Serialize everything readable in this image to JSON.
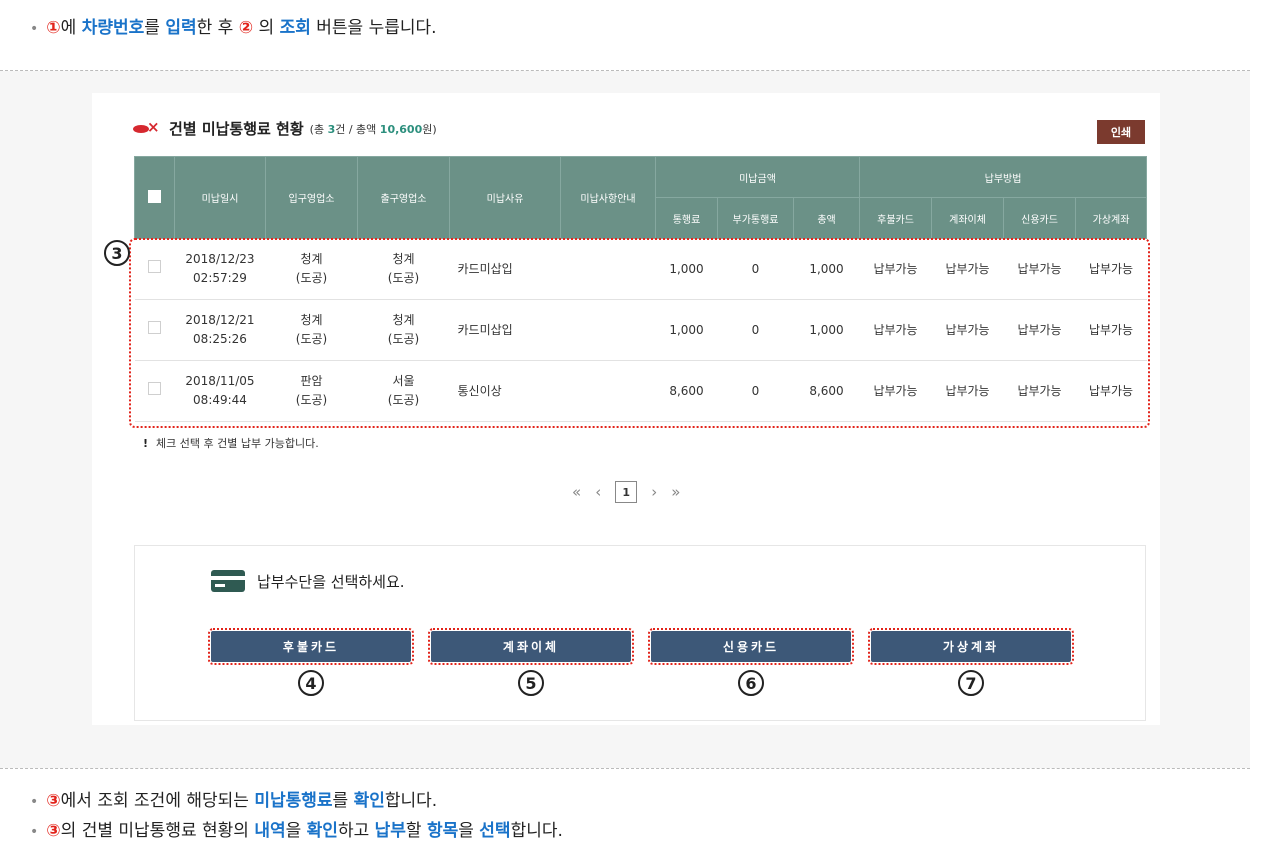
{
  "instructions": {
    "top": [
      "①",
      "에 ",
      "차량번호",
      "를 ",
      "입력",
      "한 후 ",
      "②",
      " 의 ",
      "조회",
      " 버튼을 누릅니다."
    ],
    "bottom1": [
      "③",
      "에서 조회 조건에 해당되는 ",
      "미납통행료",
      "를 ",
      "확인",
      "합니다."
    ],
    "bottom2": [
      "③",
      "의 건별 미납통행료 현황의 ",
      "내역",
      "을 ",
      "확인",
      "하고 ",
      "납부",
      "할 ",
      "항목",
      "을 ",
      "선택",
      "합니다."
    ],
    "bullet": "•"
  },
  "section": {
    "title": "건별 미납통행료 현황",
    "summary_prefix": "(총 ",
    "count": "3",
    "count_unit": "건 / 총액 ",
    "total": "10,600",
    "summary_suffix": "원)",
    "print_label": "인쇄"
  },
  "table": {
    "headers": {
      "date": "미납일시",
      "entry": "입구영업소",
      "exit": "출구영업소",
      "reason": "미납사유",
      "guide": "미납사항안내",
      "amount_group": "미납금액",
      "method_group": "납부방법",
      "toll": "통행료",
      "extra": "부가통행료",
      "sum": "총액",
      "postpaid": "후불카드",
      "transfer": "계좌이체",
      "credit": "신용카드",
      "virtual": "가상계좌"
    },
    "rows": [
      {
        "date": "2018/12/23",
        "time": "02:57:29",
        "entry": "청계",
        "entry_type": "(도공)",
        "exit": "청계",
        "exit_type": "(도공)",
        "reason": "카드미삽입",
        "guide": "",
        "toll": "1,000",
        "extra": "0",
        "sum": "1,000",
        "m1": "납부가능",
        "m2": "납부가능",
        "m3": "납부가능",
        "m4": "납부가능"
      },
      {
        "date": "2018/12/21",
        "time": "08:25:26",
        "entry": "청계",
        "entry_type": "(도공)",
        "exit": "청계",
        "exit_type": "(도공)",
        "reason": "카드미삽입",
        "guide": "",
        "toll": "1,000",
        "extra": "0",
        "sum": "1,000",
        "m1": "납부가능",
        "m2": "납부가능",
        "m3": "납부가능",
        "m4": "납부가능"
      },
      {
        "date": "2018/11/05",
        "time": "08:49:44",
        "entry": "판암",
        "entry_type": "(도공)",
        "exit": "서울",
        "exit_type": "(도공)",
        "reason": "통신이상",
        "guide": "",
        "toll": "8,600",
        "extra": "0",
        "sum": "8,600",
        "m1": "납부가능",
        "m2": "납부가능",
        "m3": "납부가능",
        "m4": "납부가능"
      }
    ]
  },
  "note": {
    "mark": "!",
    "text": "체크 선택 후 건별 납부 가능합니다."
  },
  "pager": {
    "first": "«",
    "prev": "‹",
    "current": "1",
    "next": "›",
    "last": "»"
  },
  "payment": {
    "title": "납부수단을 선택하세요.",
    "buttons": [
      "후불카드",
      "계좌이체",
      "신용카드",
      "가상계좌"
    ]
  },
  "markers": {
    "m3": "3",
    "m4": "4",
    "m5": "5",
    "m6": "6",
    "m7": "7"
  },
  "colors": {
    "header": "#6b9187",
    "button": "#3d5878",
    "print": "#7b3a2e",
    "highlight": "#e2231a",
    "keyword": "#1a73c9"
  }
}
